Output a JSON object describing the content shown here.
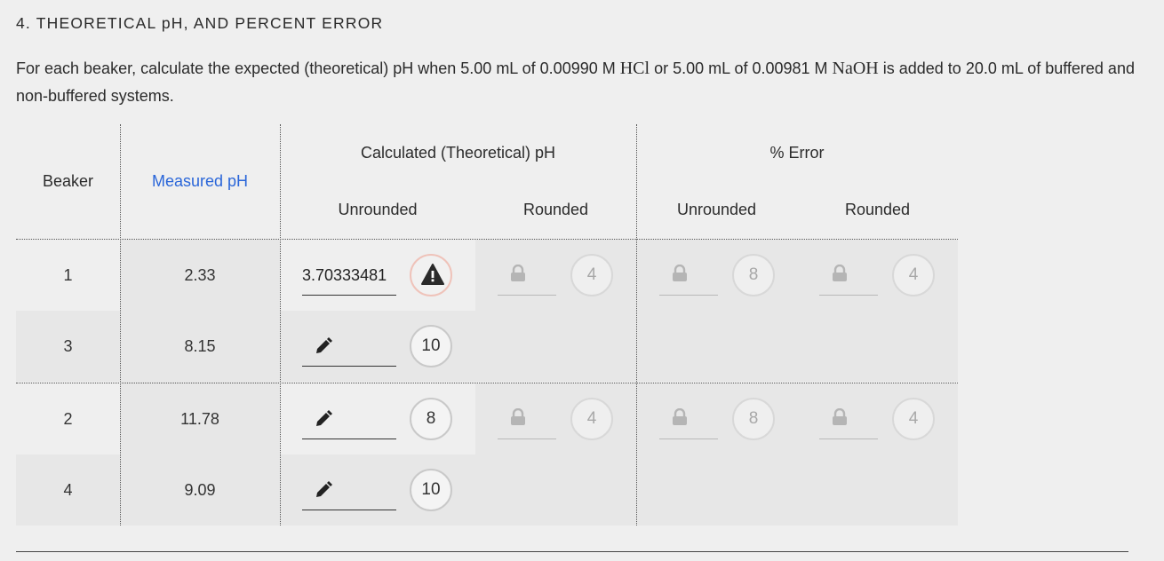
{
  "section_title": "4. THEORETICAL pH, AND PERCENT ERROR",
  "instructions": {
    "text_a": "For each beaker, calculate the expected (theoretical) pH when 5.00 mL of 0.00990 M ",
    "acid": "HCl",
    "text_b": " or 5.00 mL of 0.00981 M ",
    "base": "NaOH",
    "text_c": " is added to 20.0 mL of buffered and non-buffered systems."
  },
  "table": {
    "headers": {
      "beaker": "Beaker",
      "measured_ph": "Measured pH",
      "calculated": "Calculated (Theoretical) pH",
      "percent_error": "% Error",
      "unrounded": "Unrounded",
      "rounded": "Rounded"
    },
    "rows": [
      {
        "beaker": "1",
        "measured_ph": "2.33",
        "calc_unrounded_value": "3.70333481",
        "calc_unrounded_attempts": "!",
        "calc_rounded_attempts": "4",
        "err_unrounded_attempts": "8",
        "err_rounded_attempts": "4"
      },
      {
        "beaker": "3",
        "measured_ph": "8.15",
        "calc_unrounded_value": "",
        "calc_unrounded_attempts": "10"
      },
      {
        "beaker": "2",
        "measured_ph": "11.78",
        "calc_unrounded_value": "",
        "calc_unrounded_attempts": "8",
        "calc_rounded_attempts": "4",
        "err_unrounded_attempts": "8",
        "err_rounded_attempts": "4"
      },
      {
        "beaker": "4",
        "measured_ph": "9.09",
        "calc_unrounded_value": "",
        "calc_unrounded_attempts": "10"
      }
    ]
  },
  "icons": {
    "edit": "pencil-icon",
    "locked": "lock-icon",
    "warning": "warning-icon"
  },
  "colors": {
    "accent_blue": "#2a66d9",
    "warning_ring": "#efc3ba"
  }
}
